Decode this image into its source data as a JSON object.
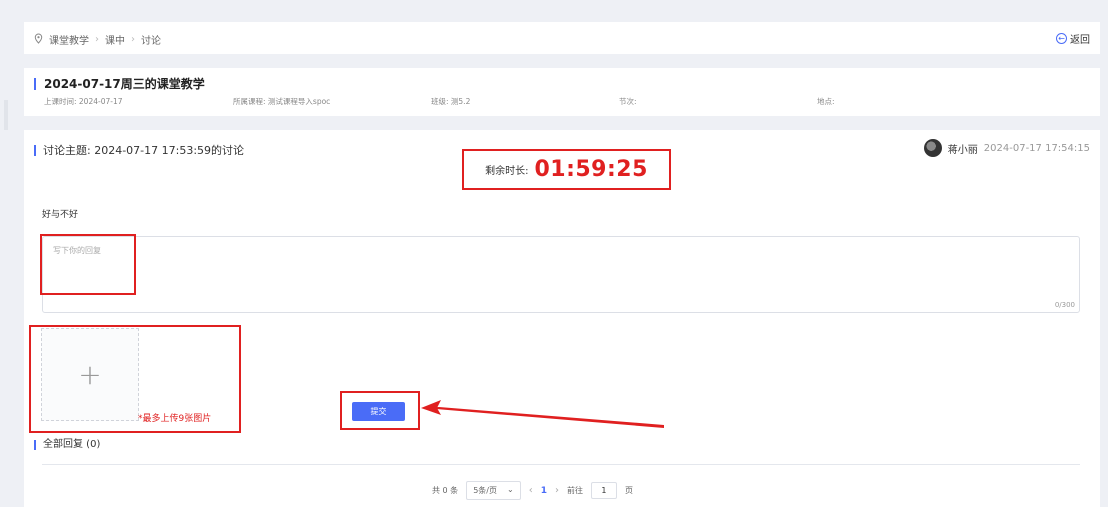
{
  "breadcrumb": [
    "课堂教学",
    "课中",
    "讨论"
  ],
  "back_label": "返回",
  "lesson": {
    "title": "2024-07-17周三的课堂教学",
    "time": "上课时间: 2024-07-17",
    "course": "所属课程: 测试课程导入spoc",
    "class": "班级: 测5.2",
    "period": "节次:",
    "location": "地点:"
  },
  "discussion": {
    "topic": "讨论主题: 2024-07-17 17:53:59的讨论",
    "author": "蒋小丽",
    "author_time": "2024-07-17 17:54:15",
    "timer_label": "剩余时长:",
    "timer_value": "01:59:25",
    "question": "好与不好",
    "reply_placeholder": "写下你的回复",
    "reply_value": "",
    "counter": "0/300",
    "upload_note": "*最多上传9张图片",
    "submit_label": "提交",
    "all_replies": "全部回复 (0)"
  },
  "pagination": {
    "total": "共 0 条",
    "page_size": "5条/页",
    "current_page": "1",
    "goto_label": "前往",
    "goto_value": "1",
    "page_suffix": "页"
  },
  "colors": {
    "accent": "#4a6cf7",
    "highlight": "#e02020"
  }
}
